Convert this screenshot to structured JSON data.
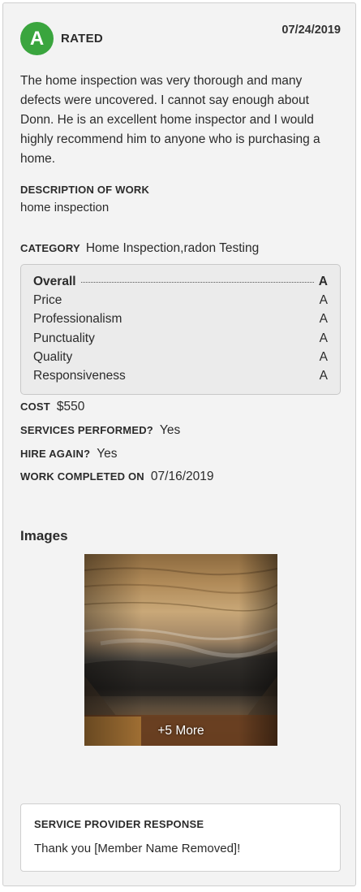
{
  "review": {
    "grade": "A",
    "rated_label": "RATED",
    "date": "07/24/2019",
    "text": "The home inspection was very thorough and many defects were uncovered. I cannot say enough about Donn. He is an excellent home inspector and I would highly recommend him to anyone who is purchasing a home."
  },
  "description": {
    "label": "DESCRIPTION OF WORK",
    "value": "home inspection"
  },
  "category": {
    "label": "CATEGORY",
    "value": "Home Inspection,radon Testing"
  },
  "ratings": [
    {
      "name": "Overall",
      "grade": "A"
    },
    {
      "name": "Price",
      "grade": "A"
    },
    {
      "name": "Professionalism",
      "grade": "A"
    },
    {
      "name": "Punctuality",
      "grade": "A"
    },
    {
      "name": "Quality",
      "grade": "A"
    },
    {
      "name": "Responsiveness",
      "grade": "A"
    }
  ],
  "details": {
    "cost": {
      "label": "COST",
      "value": "$550"
    },
    "services_performed": {
      "label": "SERVICES PERFORMED?",
      "value": "Yes"
    },
    "hire_again": {
      "label": "HIRE AGAIN?",
      "value": "Yes"
    },
    "work_completed": {
      "label": "WORK COMPLETED ON",
      "value": "07/16/2019"
    }
  },
  "images": {
    "heading": "Images",
    "more_label": "+5 More"
  },
  "response": {
    "label": "SERVICE PROVIDER RESPONSE",
    "text": "Thank you [Member Name Removed]!"
  },
  "colors": {
    "grade_badge": "#3aa53e",
    "card_background": "#f3f3f3",
    "ratings_background": "#ebebeb"
  }
}
